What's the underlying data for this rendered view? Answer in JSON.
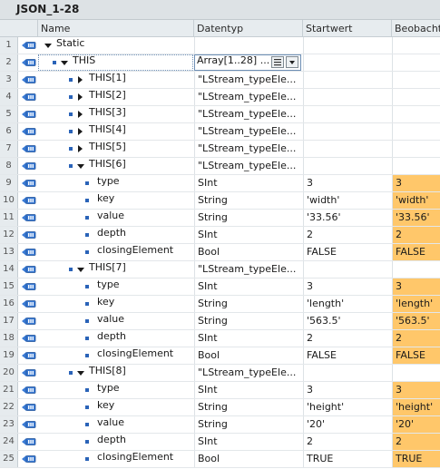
{
  "window": {
    "title": "JSON_1-28"
  },
  "columns": {
    "name": "Name",
    "datatype": "Datentyp",
    "startvalue": "Startwert",
    "observe": "Beobacht"
  },
  "rows": [
    {
      "num": "1",
      "level": 0,
      "toggle": "down",
      "bullet": false,
      "name": "Static",
      "dt": "",
      "sw": "",
      "ob": "",
      "hi": false,
      "sel": false
    },
    {
      "num": "2",
      "level": 1,
      "toggle": "down",
      "bullet": true,
      "name": "THIS",
      "dt": "Array[1..28] ...",
      "sw": "",
      "ob": "",
      "hi": false,
      "sel": true
    },
    {
      "num": "3",
      "level": 2,
      "toggle": "right",
      "bullet": true,
      "name": "THIS[1]",
      "dt": "\"LStream_typeEle...",
      "sw": "",
      "ob": "",
      "hi": false,
      "sel": false
    },
    {
      "num": "4",
      "level": 2,
      "toggle": "right",
      "bullet": true,
      "name": "THIS[2]",
      "dt": "\"LStream_typeEle...",
      "sw": "",
      "ob": "",
      "hi": false,
      "sel": false
    },
    {
      "num": "5",
      "level": 2,
      "toggle": "right",
      "bullet": true,
      "name": "THIS[3]",
      "dt": "\"LStream_typeEle...",
      "sw": "",
      "ob": "",
      "hi": false,
      "sel": false
    },
    {
      "num": "6",
      "level": 2,
      "toggle": "right",
      "bullet": true,
      "name": "THIS[4]",
      "dt": "\"LStream_typeEle...",
      "sw": "",
      "ob": "",
      "hi": false,
      "sel": false
    },
    {
      "num": "7",
      "level": 2,
      "toggle": "right",
      "bullet": true,
      "name": "THIS[5]",
      "dt": "\"LStream_typeEle...",
      "sw": "",
      "ob": "",
      "hi": false,
      "sel": false
    },
    {
      "num": "8",
      "level": 2,
      "toggle": "down",
      "bullet": true,
      "name": "THIS[6]",
      "dt": "\"LStream_typeEle...",
      "sw": "",
      "ob": "",
      "hi": false,
      "sel": false
    },
    {
      "num": "9",
      "level": 3,
      "toggle": "none",
      "bullet": true,
      "name": "type",
      "dt": "SInt",
      "sw": "3",
      "ob": "3",
      "hi": true,
      "sel": false
    },
    {
      "num": "10",
      "level": 3,
      "toggle": "none",
      "bullet": true,
      "name": "key",
      "dt": "String",
      "sw": "'width'",
      "ob": "'width'",
      "hi": true,
      "sel": false
    },
    {
      "num": "11",
      "level": 3,
      "toggle": "none",
      "bullet": true,
      "name": "value",
      "dt": "String",
      "sw": "'33.56'",
      "ob": "'33.56'",
      "hi": true,
      "sel": false
    },
    {
      "num": "12",
      "level": 3,
      "toggle": "none",
      "bullet": true,
      "name": "depth",
      "dt": "SInt",
      "sw": "2",
      "ob": "2",
      "hi": true,
      "sel": false
    },
    {
      "num": "13",
      "level": 3,
      "toggle": "none",
      "bullet": true,
      "name": "closingElement",
      "dt": "Bool",
      "sw": "FALSE",
      "ob": "FALSE",
      "hi": true,
      "sel": false
    },
    {
      "num": "14",
      "level": 2,
      "toggle": "down",
      "bullet": true,
      "name": "THIS[7]",
      "dt": "\"LStream_typeEle...",
      "sw": "",
      "ob": "",
      "hi": false,
      "sel": false
    },
    {
      "num": "15",
      "level": 3,
      "toggle": "none",
      "bullet": true,
      "name": "type",
      "dt": "SInt",
      "sw": "3",
      "ob": "3",
      "hi": true,
      "sel": false
    },
    {
      "num": "16",
      "level": 3,
      "toggle": "none",
      "bullet": true,
      "name": "key",
      "dt": "String",
      "sw": "'length'",
      "ob": "'length'",
      "hi": true,
      "sel": false
    },
    {
      "num": "17",
      "level": 3,
      "toggle": "none",
      "bullet": true,
      "name": "value",
      "dt": "String",
      "sw": "'563.5'",
      "ob": "'563.5'",
      "hi": true,
      "sel": false
    },
    {
      "num": "18",
      "level": 3,
      "toggle": "none",
      "bullet": true,
      "name": "depth",
      "dt": "SInt",
      "sw": "2",
      "ob": "2",
      "hi": true,
      "sel": false
    },
    {
      "num": "19",
      "level": 3,
      "toggle": "none",
      "bullet": true,
      "name": "closingElement",
      "dt": "Bool",
      "sw": "FALSE",
      "ob": "FALSE",
      "hi": true,
      "sel": false
    },
    {
      "num": "20",
      "level": 2,
      "toggle": "down",
      "bullet": true,
      "name": "THIS[8]",
      "dt": "\"LStream_typeEle...",
      "sw": "",
      "ob": "",
      "hi": false,
      "sel": false
    },
    {
      "num": "21",
      "level": 3,
      "toggle": "none",
      "bullet": true,
      "name": "type",
      "dt": "SInt",
      "sw": "3",
      "ob": "3",
      "hi": true,
      "sel": false
    },
    {
      "num": "22",
      "level": 3,
      "toggle": "none",
      "bullet": true,
      "name": "key",
      "dt": "String",
      "sw": "'height'",
      "ob": "'height'",
      "hi": true,
      "sel": false
    },
    {
      "num": "23",
      "level": 3,
      "toggle": "none",
      "bullet": true,
      "name": "value",
      "dt": "String",
      "sw": "'20'",
      "ob": "'20'",
      "hi": true,
      "sel": false
    },
    {
      "num": "24",
      "level": 3,
      "toggle": "none",
      "bullet": true,
      "name": "depth",
      "dt": "SInt",
      "sw": "2",
      "ob": "2",
      "hi": true,
      "sel": false
    },
    {
      "num": "25",
      "level": 3,
      "toggle": "none",
      "bullet": true,
      "name": "closingElement",
      "dt": "Bool",
      "sw": "TRUE",
      "ob": "TRUE",
      "hi": true,
      "sel": false
    }
  ],
  "colors": {
    "highlight": "#ffc76a",
    "bullet": "#2a63b8",
    "header": "#e7ecef"
  },
  "icons": {
    "row_icon": "db-interface-icon",
    "list_button": "list-icon",
    "dropdown_button": "chevron-down-icon"
  }
}
